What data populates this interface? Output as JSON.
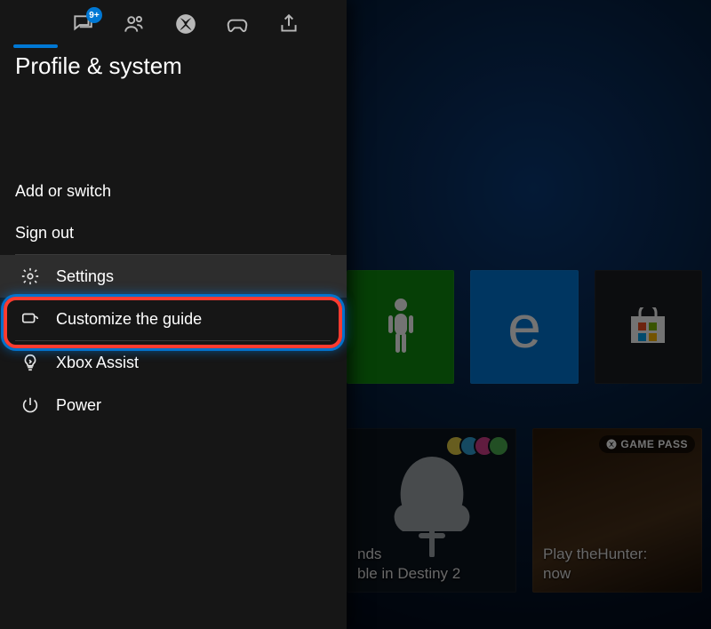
{
  "guide": {
    "title": "Profile & system",
    "notif_badge": "9+",
    "tabs": [
      {
        "name": "profile-tab",
        "icon": "profile",
        "active": true
      },
      {
        "name": "chat-tab",
        "icon": "chat",
        "active": false
      },
      {
        "name": "people-tab",
        "icon": "people",
        "active": false
      },
      {
        "name": "xbox-tab",
        "icon": "xbox",
        "active": false
      },
      {
        "name": "games-tab",
        "icon": "gamepad",
        "active": false
      },
      {
        "name": "share-tab",
        "icon": "share",
        "active": false
      }
    ],
    "items": {
      "add_switch": "Add or switch",
      "sign_out": "Sign out",
      "settings": "Settings",
      "customize": "Customize the guide",
      "assist": "Xbox Assist",
      "power": "Power"
    },
    "selected": "settings"
  },
  "dashboard": {
    "row1": [
      {
        "name": "tile-people-app",
        "color": "green",
        "icon": "person"
      },
      {
        "name": "tile-edge",
        "color": "blue",
        "icon": "edge"
      },
      {
        "name": "tile-store",
        "color": "dark",
        "icon": "store"
      }
    ],
    "row2": [
      {
        "name": "tile-destiny",
        "caption_line1": "nds",
        "caption_line2": "ble in Destiny 2"
      },
      {
        "name": "tile-gamepass",
        "badge": "GAME PASS",
        "caption_line1": "Play theHunter:",
        "caption_line2": "now"
      }
    ]
  }
}
